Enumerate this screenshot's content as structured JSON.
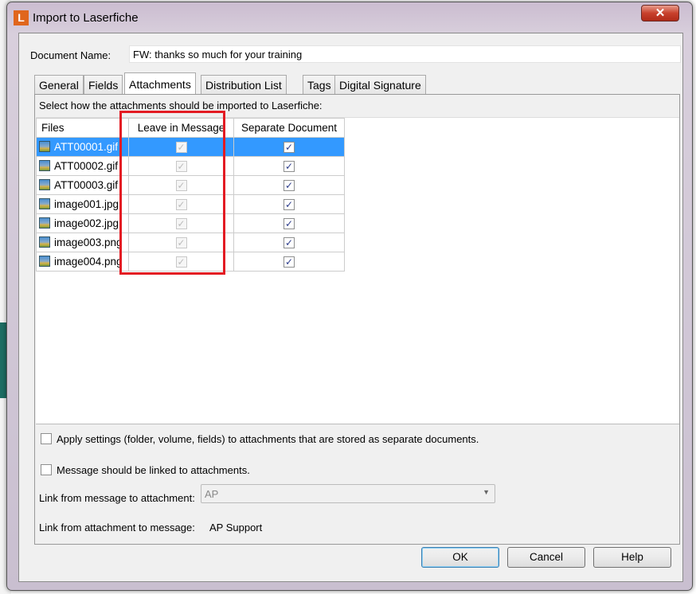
{
  "window": {
    "title": "Import to Laserfiche",
    "logo": "L",
    "close": "✕"
  },
  "document_name": {
    "label": "Document Name:",
    "value": "FW: thanks so much for your training"
  },
  "tabs": [
    "General",
    "Fields",
    "Attachments",
    "Distribution List",
    "Tags",
    "Digital Signature"
  ],
  "active_tab": "Attachments",
  "attachments": {
    "instruction": "Select how the attachments should be imported to Laserfiche:",
    "columns": [
      "Files",
      "Leave in Message",
      "Separate Document"
    ],
    "rows": [
      {
        "file": "ATT00001.gif",
        "leave": true,
        "separate": true,
        "selected": true
      },
      {
        "file": "ATT00002.gif",
        "leave": true,
        "separate": true
      },
      {
        "file": "ATT00003.gif",
        "leave": true,
        "separate": true
      },
      {
        "file": "image001.jpg",
        "leave": true,
        "separate": true
      },
      {
        "file": "image002.jpg",
        "leave": true,
        "separate": true
      },
      {
        "file": "image003.png",
        "leave": true,
        "separate": true
      },
      {
        "file": "image004.png",
        "leave": true,
        "separate": true
      }
    ],
    "apply_settings": {
      "label": "Apply settings (folder, volume, fields) to attachments that are stored as separate documents.",
      "checked": false
    },
    "message_linked": {
      "label": "Message should be linked to attachments.",
      "checked": false
    },
    "link_msg_to_att": {
      "label": "Link from message to attachment:",
      "value": "AP"
    },
    "link_att_to_msg": {
      "label": "Link from attachment to message:",
      "value": "AP Support"
    }
  },
  "buttons": {
    "ok": "OK",
    "cancel": "Cancel",
    "help": "Help"
  },
  "colors": {
    "highlight": "#3399ff",
    "annotation": "#e31b23",
    "logo": "#e0661c"
  }
}
